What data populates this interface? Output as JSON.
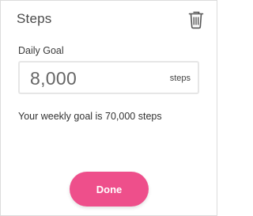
{
  "dialog": {
    "title": "Steps",
    "delete_icon": "trash-icon"
  },
  "goal": {
    "label": "Daily Goal",
    "value": "8,000",
    "unit": "steps"
  },
  "weekly": {
    "text": "Your weekly goal is 70,000 steps"
  },
  "actions": {
    "done_label": "Done"
  },
  "colors": {
    "accent": "#ee4f8b",
    "border": "#dcdcdc",
    "field_border": "#e6e6e6"
  }
}
